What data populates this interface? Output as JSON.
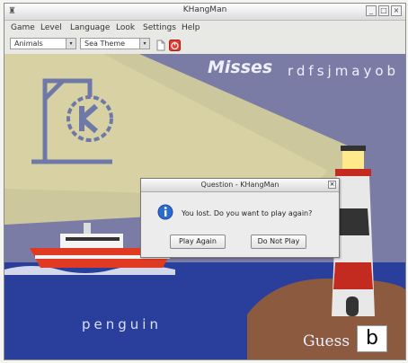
{
  "window": {
    "title": "KHangMan",
    "minimize_glyph": "_",
    "maximize_glyph": "□",
    "close_glyph": "×"
  },
  "menu": [
    "Game",
    "Level",
    "Language",
    "Look",
    "Settings",
    "Help"
  ],
  "toolbar": {
    "category": "Animals",
    "theme": "Sea Theme",
    "combo_arrow": "▾",
    "icons": [
      "new-document-icon",
      "quit-icon"
    ]
  },
  "game": {
    "misses_label": "Misses",
    "missed_letters": "rdfsjmayob",
    "word": "penguin",
    "guess_label": "Guess",
    "guess_value": "b"
  },
  "dialog": {
    "title": "Question - KHangMan",
    "close_glyph": "×",
    "message": "You lost. Do you want to play again?",
    "play_again": "Play Again",
    "do_not_play": "Do Not Play"
  },
  "colors": {
    "sea": "#2a3f9c",
    "sky": "#7a7ba4",
    "beam": "#d6cf9c",
    "island": "#8c5a3f",
    "boat": "#e03a23"
  }
}
